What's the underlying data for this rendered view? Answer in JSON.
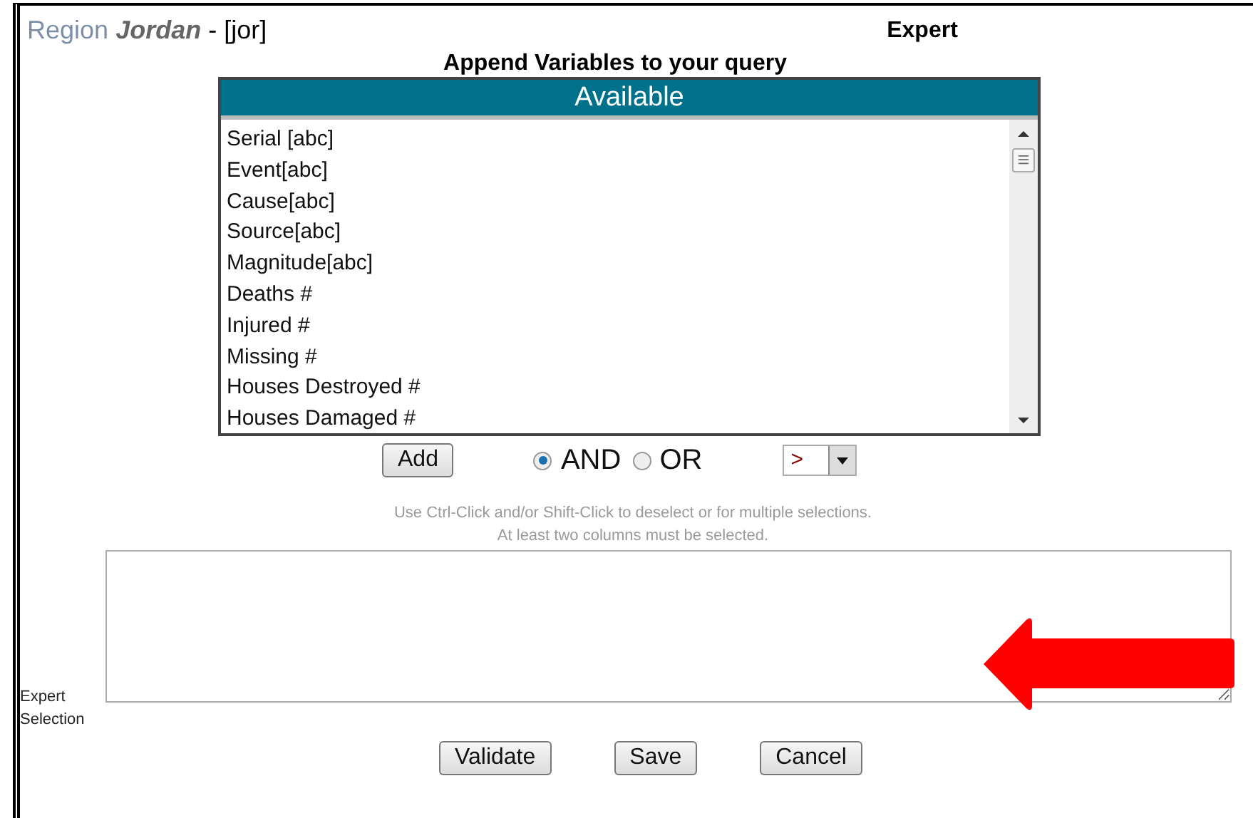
{
  "region": {
    "label": "Region",
    "name": "Jordan",
    "code": "- [jor]"
  },
  "mode": "Expert",
  "title": "Append Variables to your query",
  "available": {
    "header": "Available",
    "items": [
      {
        "label": "Serial [abc]",
        "selected": false
      },
      {
        "label": "Event[abc]",
        "selected": false
      },
      {
        "label": "Cause[abc]",
        "selected": false
      },
      {
        "label": "Source[abc]",
        "selected": false
      },
      {
        "label": "Magnitude[abc]",
        "selected": false
      },
      {
        "label": "Deaths #",
        "selected": false
      },
      {
        "label": "Injured #",
        "selected": false
      },
      {
        "label": "Missing #",
        "selected": false
      },
      {
        "label": "Houses Destroyed #",
        "selected": false
      },
      {
        "label": "Houses Damaged #",
        "selected": false
      }
    ]
  },
  "add_button": "Add",
  "logic": [
    {
      "label": "AND",
      "selected": true
    },
    {
      "label": "OR",
      "selected": false
    }
  ],
  "operator": {
    "value": ">"
  },
  "hints": [
    "Use Ctrl-Click and/or Shift-Click to deselect or for multiple selections.",
    "At least two columns must be selected."
  ],
  "expert_selection": {
    "label_lines": [
      "Expert",
      "Selection"
    ]
  },
  "buttons": [
    "Validate",
    "Save",
    "Cancel"
  ]
}
